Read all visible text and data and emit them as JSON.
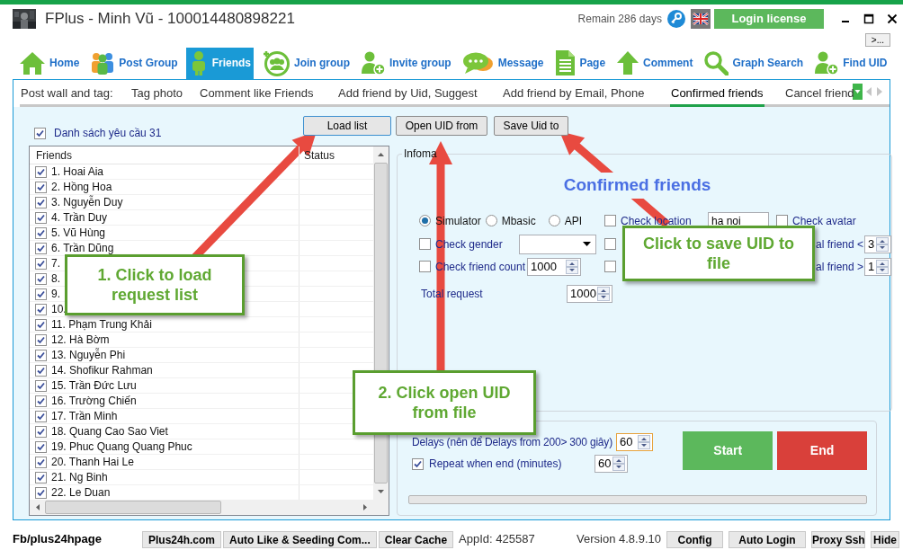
{
  "window": {
    "title": "FPlus - Minh Vũ - 100014480898221",
    "remain": "Remain 286 days",
    "login_button": "Login license"
  },
  "more_button": ">...",
  "toolbar": [
    {
      "label": "Home",
      "kind": "home",
      "selected": false
    },
    {
      "label": "Post Group",
      "kind": "people",
      "selected": false
    },
    {
      "label": "Friends",
      "kind": "person",
      "selected": true
    },
    {
      "label": "Join group",
      "kind": "group",
      "selected": false
    },
    {
      "label": "Invite group",
      "kind": "adduser",
      "selected": false
    },
    {
      "label": "Message",
      "kind": "chat",
      "selected": false
    },
    {
      "label": "Page",
      "kind": "page",
      "selected": false
    },
    {
      "label": "Comment",
      "kind": "up",
      "selected": false
    },
    {
      "label": "Graph Search",
      "kind": "search",
      "selected": false
    },
    {
      "label": "Find UID",
      "kind": "adduser",
      "selected": false
    }
  ],
  "tabs": [
    {
      "label": "Post wall and tag:",
      "selected": false
    },
    {
      "label": "Tag photo",
      "selected": false
    },
    {
      "label": "Comment like Friends",
      "selected": false
    },
    {
      "label": "Add friend by Uid, Suggest",
      "selected": false
    },
    {
      "label": "Add friend by Email, Phone",
      "selected": false
    },
    {
      "label": "Confirmed friends",
      "selected": true
    },
    {
      "label": "Cancel friend",
      "selected": false
    }
  ],
  "request_list": {
    "label": "Danh sách yêu cầu 31",
    "checked": true
  },
  "buttons": [
    "Load list",
    "Open UID from",
    "Save Uid to"
  ],
  "list": {
    "columns": [
      "Friends",
      "Status"
    ],
    "rows": [
      {
        "name": "1. Hoai Aia",
        "checked": true
      },
      {
        "name": "2. Hồng Hoa",
        "checked": true
      },
      {
        "name": "3. Nguyễn Duy",
        "checked": true
      },
      {
        "name": "4. Trần Duy",
        "checked": true
      },
      {
        "name": "5. Vũ Hùng",
        "checked": true
      },
      {
        "name": "6. Trần Dũng",
        "checked": true
      },
      {
        "name": "7.",
        "checked": true
      },
      {
        "name": "8.",
        "checked": true
      },
      {
        "name": "9.",
        "checked": true
      },
      {
        "name": "10.",
        "checked": true
      },
      {
        "name": "11. Phạm Trung Khải",
        "checked": true
      },
      {
        "name": "12. Hà Bờm",
        "checked": true
      },
      {
        "name": "13. Nguyễn Phi",
        "checked": true
      },
      {
        "name": "14. Shofikur Rahman",
        "checked": true
      },
      {
        "name": "15. Trần Đức Lưu",
        "checked": true
      },
      {
        "name": "16. Trường Chiến",
        "checked": true
      },
      {
        "name": "17. Trần Minh",
        "checked": true
      },
      {
        "name": "18. Quang Cao Sao Viet",
        "checked": true
      },
      {
        "name": "19. Phuc Quang Quang Phuc",
        "checked": true
      },
      {
        "name": "20. Thanh Hai Le",
        "checked": true
      },
      {
        "name": "21. Ng Binh",
        "checked": true
      },
      {
        "name": "22. Le Duan",
        "checked": true
      }
    ]
  },
  "info": {
    "legend": "Infoma",
    "title": "Confirmed friends",
    "modes": [
      {
        "label": "Simulator",
        "selected": true
      },
      {
        "label": "Mbasic",
        "selected": false
      },
      {
        "label": "API",
        "selected": false
      }
    ],
    "check_location": {
      "label": "Check location",
      "checked": false,
      "value": "ha noi"
    },
    "check_avatar": {
      "label": "Check avatar",
      "checked": false
    },
    "check_gender": {
      "label": "Check gender",
      "checked": false
    },
    "check_friend_count": {
      "label": "Check friend count",
      "checked": false,
      "value": "1000"
    },
    "mutual_min": {
      "label": "al friend <",
      "checked": false,
      "value": "3"
    },
    "mutual_max": {
      "label": "al friend >",
      "checked": false,
      "value": "1"
    },
    "total_request": {
      "label": "Total request",
      "value": "1000"
    }
  },
  "schedule": {
    "delay_label": "Delays (nên để Delays from 200> 300 giây)",
    "delay_value": "60",
    "repeat": {
      "label": "Repeat when end (minutes)",
      "checked": true,
      "value": "60"
    },
    "start": "Start",
    "end": "End",
    "progress": {
      "level": 0
    }
  },
  "status_bar": {
    "page": "Fb/plus24hpage",
    "left_buttons": [
      "Plus24h.com",
      "Auto Like & Seeding Com...",
      "Clear Cache"
    ],
    "app_id": "AppId: 425587",
    "version": "Version 4.8.9.10",
    "right_buttons": [
      "Config",
      "Auto Login",
      "Proxy Ssh",
      "Hide"
    ]
  },
  "callouts": [
    {
      "text": "1. Click to load request list"
    },
    {
      "text": "2. Click open UID from file"
    },
    {
      "text": "Click to save UID to file"
    }
  ]
}
